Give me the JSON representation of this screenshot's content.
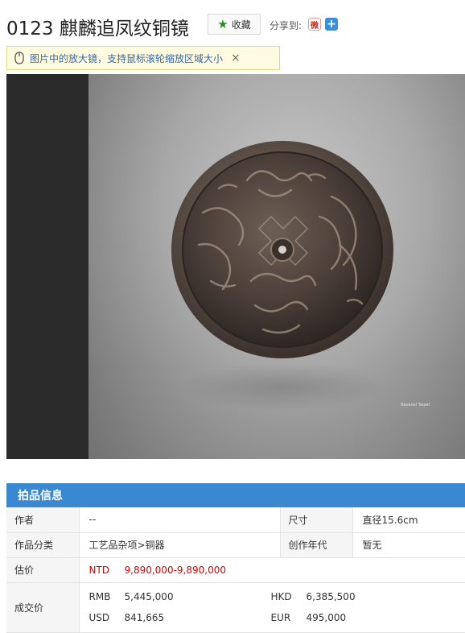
{
  "lot": {
    "title": "0123 麒麟追凤纹铜镜",
    "favorite_label": "收藏",
    "share_label": "分享到:"
  },
  "tip": {
    "text": "图片中的放大镜，支持鼠标滚轮缩放区域大小",
    "close": "×"
  },
  "photo": {
    "watermark": "Ravenel Taipei"
  },
  "info": {
    "heading": "拍品信息",
    "author_label": "作者",
    "author_value": "--",
    "size_label": "尺寸",
    "size_value": "直径15.6cm",
    "category_label": "作品分类",
    "category_value": "工艺品杂项>铜器",
    "era_label": "创作年代",
    "era_value": "暂无",
    "estimate_label": "估价",
    "estimate_currency": "NTD",
    "estimate_value": "9,890,000-9,890,000",
    "sold_label": "成交价",
    "sold": [
      {
        "currency": "RMB",
        "value": "5,445,000"
      },
      {
        "currency": "HKD",
        "value": "6,385,500"
      },
      {
        "currency": "USD",
        "value": "841,665"
      },
      {
        "currency": "EUR",
        "value": "495,000"
      }
    ]
  },
  "colors": {
    "accent": "#3a88d0",
    "price_red": "#d40000"
  }
}
